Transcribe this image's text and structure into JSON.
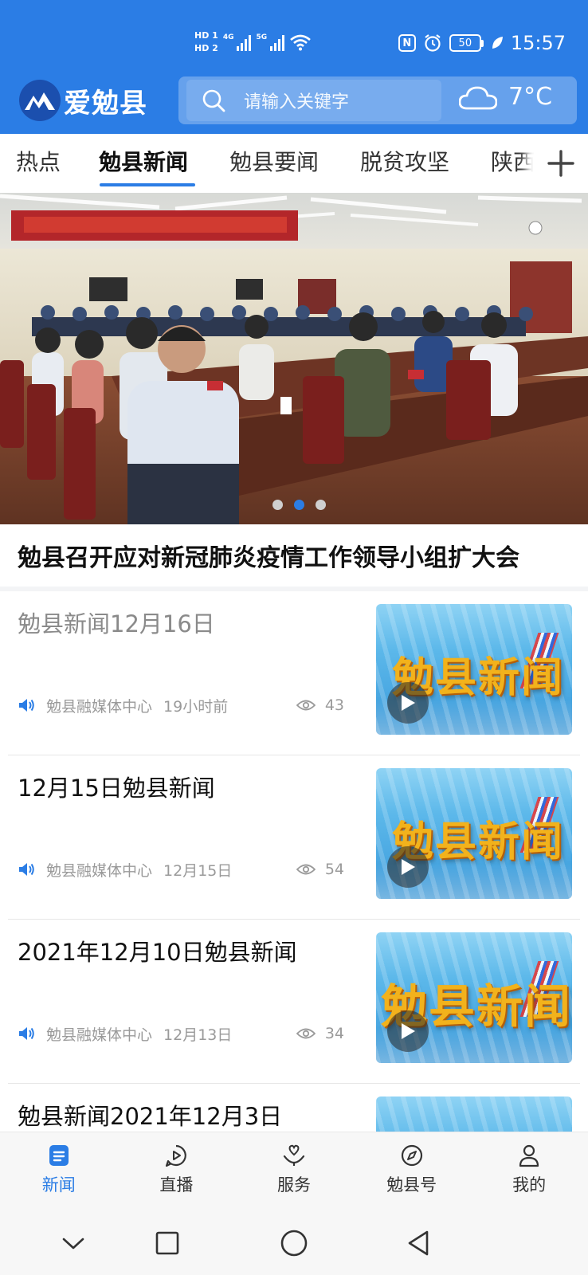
{
  "status_bar": {
    "hd1": "HD 1",
    "hd2": "HD 2",
    "net1": "4G",
    "net2": "5G",
    "nfc": "N",
    "battery": "50",
    "time": "15:57"
  },
  "app": {
    "logo_text": "爱勉县",
    "search_placeholder": "请输入关键字",
    "weather_temp": "7°C",
    "weather_icon": "cloud-icon"
  },
  "tabs": [
    {
      "label": "热点"
    },
    {
      "label": "勉县新闻",
      "active": true
    },
    {
      "label": "勉县要闻"
    },
    {
      "label": "脱贫攻坚"
    },
    {
      "label": "陕西"
    }
  ],
  "banner": {
    "title": "勉县召开应对新冠肺炎疫情工作领导小组扩大会",
    "slide_count": 3,
    "active_slide": 2
  },
  "news": [
    {
      "title": "勉县新闻12月16日",
      "read": true,
      "source": "勉县融媒体中心",
      "time": "19小时前",
      "views": "43",
      "thumb_text": "勉县新闻"
    },
    {
      "title": "12月15日勉县新闻",
      "read": false,
      "source": "勉县融媒体中心",
      "time": "12月15日",
      "views": "54",
      "thumb_text": "勉县新闻"
    },
    {
      "title": "2021年12月10日勉县新闻",
      "read": false,
      "source": "勉县融媒体中心",
      "time": "12月13日",
      "views": "34",
      "thumb_text": "勉县新闻"
    },
    {
      "title": "勉县新闻2021年12月3日",
      "read": false,
      "source": "",
      "time": "",
      "views": "",
      "thumb_text": ""
    }
  ],
  "bottom_nav": [
    {
      "label": "新闻",
      "icon": "news-icon",
      "active": true
    },
    {
      "label": "直播",
      "icon": "live-play-icon"
    },
    {
      "label": "服务",
      "icon": "service-heart-icon"
    },
    {
      "label": "勉县号",
      "icon": "compass-icon"
    },
    {
      "label": "我的",
      "icon": "profile-icon"
    }
  ],
  "colors": {
    "primary": "#2b7de5",
    "text": "#111111",
    "muted": "#9a9a9a"
  }
}
